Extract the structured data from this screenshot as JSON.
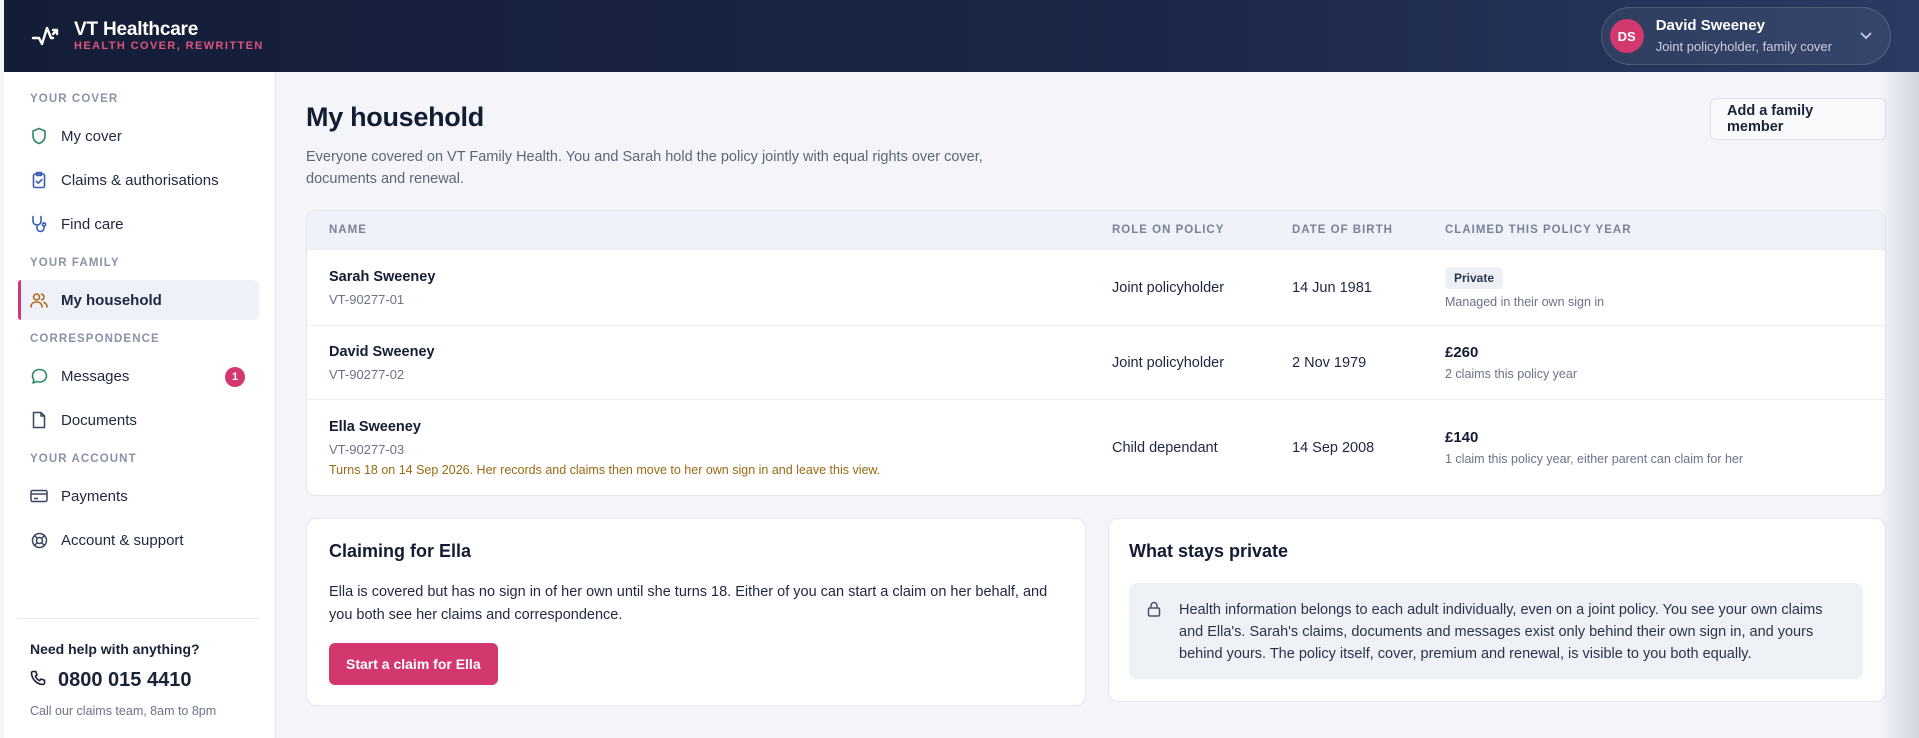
{
  "brand": {
    "name": "VT Healthcare",
    "tagline": "HEALTH COVER, REWRITTEN"
  },
  "user": {
    "initials": "DS",
    "name": "David Sweeney",
    "role": "Joint policyholder, family cover"
  },
  "sidebar": {
    "sections": [
      {
        "label": "YOUR COVER",
        "items": [
          "My cover",
          "Claims & authorisations",
          "Find care"
        ]
      },
      {
        "label": "YOUR FAMILY",
        "items": [
          "My household"
        ]
      },
      {
        "label": "CORRESPONDENCE",
        "items": [
          "Messages",
          "Documents"
        ],
        "messages_badge": "1"
      },
      {
        "label": "YOUR ACCOUNT",
        "items": [
          "Payments",
          "Account & support"
        ]
      }
    ],
    "help": {
      "question": "Need help with anything?",
      "phone": "0800 015 4410",
      "note": "Call our claims team, 8am to 8pm"
    }
  },
  "page": {
    "title": "My household",
    "subtitle": "Everyone covered on VT Family Health. You and Sarah hold the policy jointly with equal rights over cover, documents and renewal.",
    "add_button": "Add a family member"
  },
  "table": {
    "headers": [
      "NAME",
      "ROLE ON POLICY",
      "DATE OF BIRTH",
      "CLAIMED THIS POLICY YEAR"
    ],
    "rows": [
      {
        "name": "Sarah Sweeney",
        "id": "VT-90277-01",
        "role": "Joint policyholder",
        "dob": "14 Jun 1981",
        "claim_chip": "Private",
        "claim_note": "Managed in their own sign in"
      },
      {
        "name": "David Sweeney",
        "id": "VT-90277-02",
        "role": "Joint policyholder",
        "dob": "2 Nov 1979",
        "claim_amount": "£260",
        "claim_note": "2 claims this policy year"
      },
      {
        "name": "Ella Sweeney",
        "id": "VT-90277-03",
        "notice": "Turns 18 on 14 Sep 2026. Her records and claims then move to her own sign in and leave this view.",
        "role": "Child dependant",
        "dob": "14 Sep 2008",
        "claim_amount": "£140",
        "claim_note": "1 claim this policy year, either parent can claim for her"
      }
    ]
  },
  "claiming": {
    "title": "Claiming for Ella",
    "body": "Ella is covered but has no sign in of her own until she turns 18. Either of you can start a claim on her behalf, and you both see her claims and correspondence.",
    "button": "Start a claim for Ella"
  },
  "private": {
    "title": "What stays private",
    "body": "Health information belongs to each adult individually, even on a joint policy. You see your own claims and Ella's. Sarah's claims, documents and messages exist only behind their own sign in, and yours behind yours. The policy itself, cover, premium and renewal, is visible to you both equally."
  },
  "colors": {
    "accent": "#d2386e",
    "topbar": "#141d36",
    "notice": "#9a6a12"
  }
}
